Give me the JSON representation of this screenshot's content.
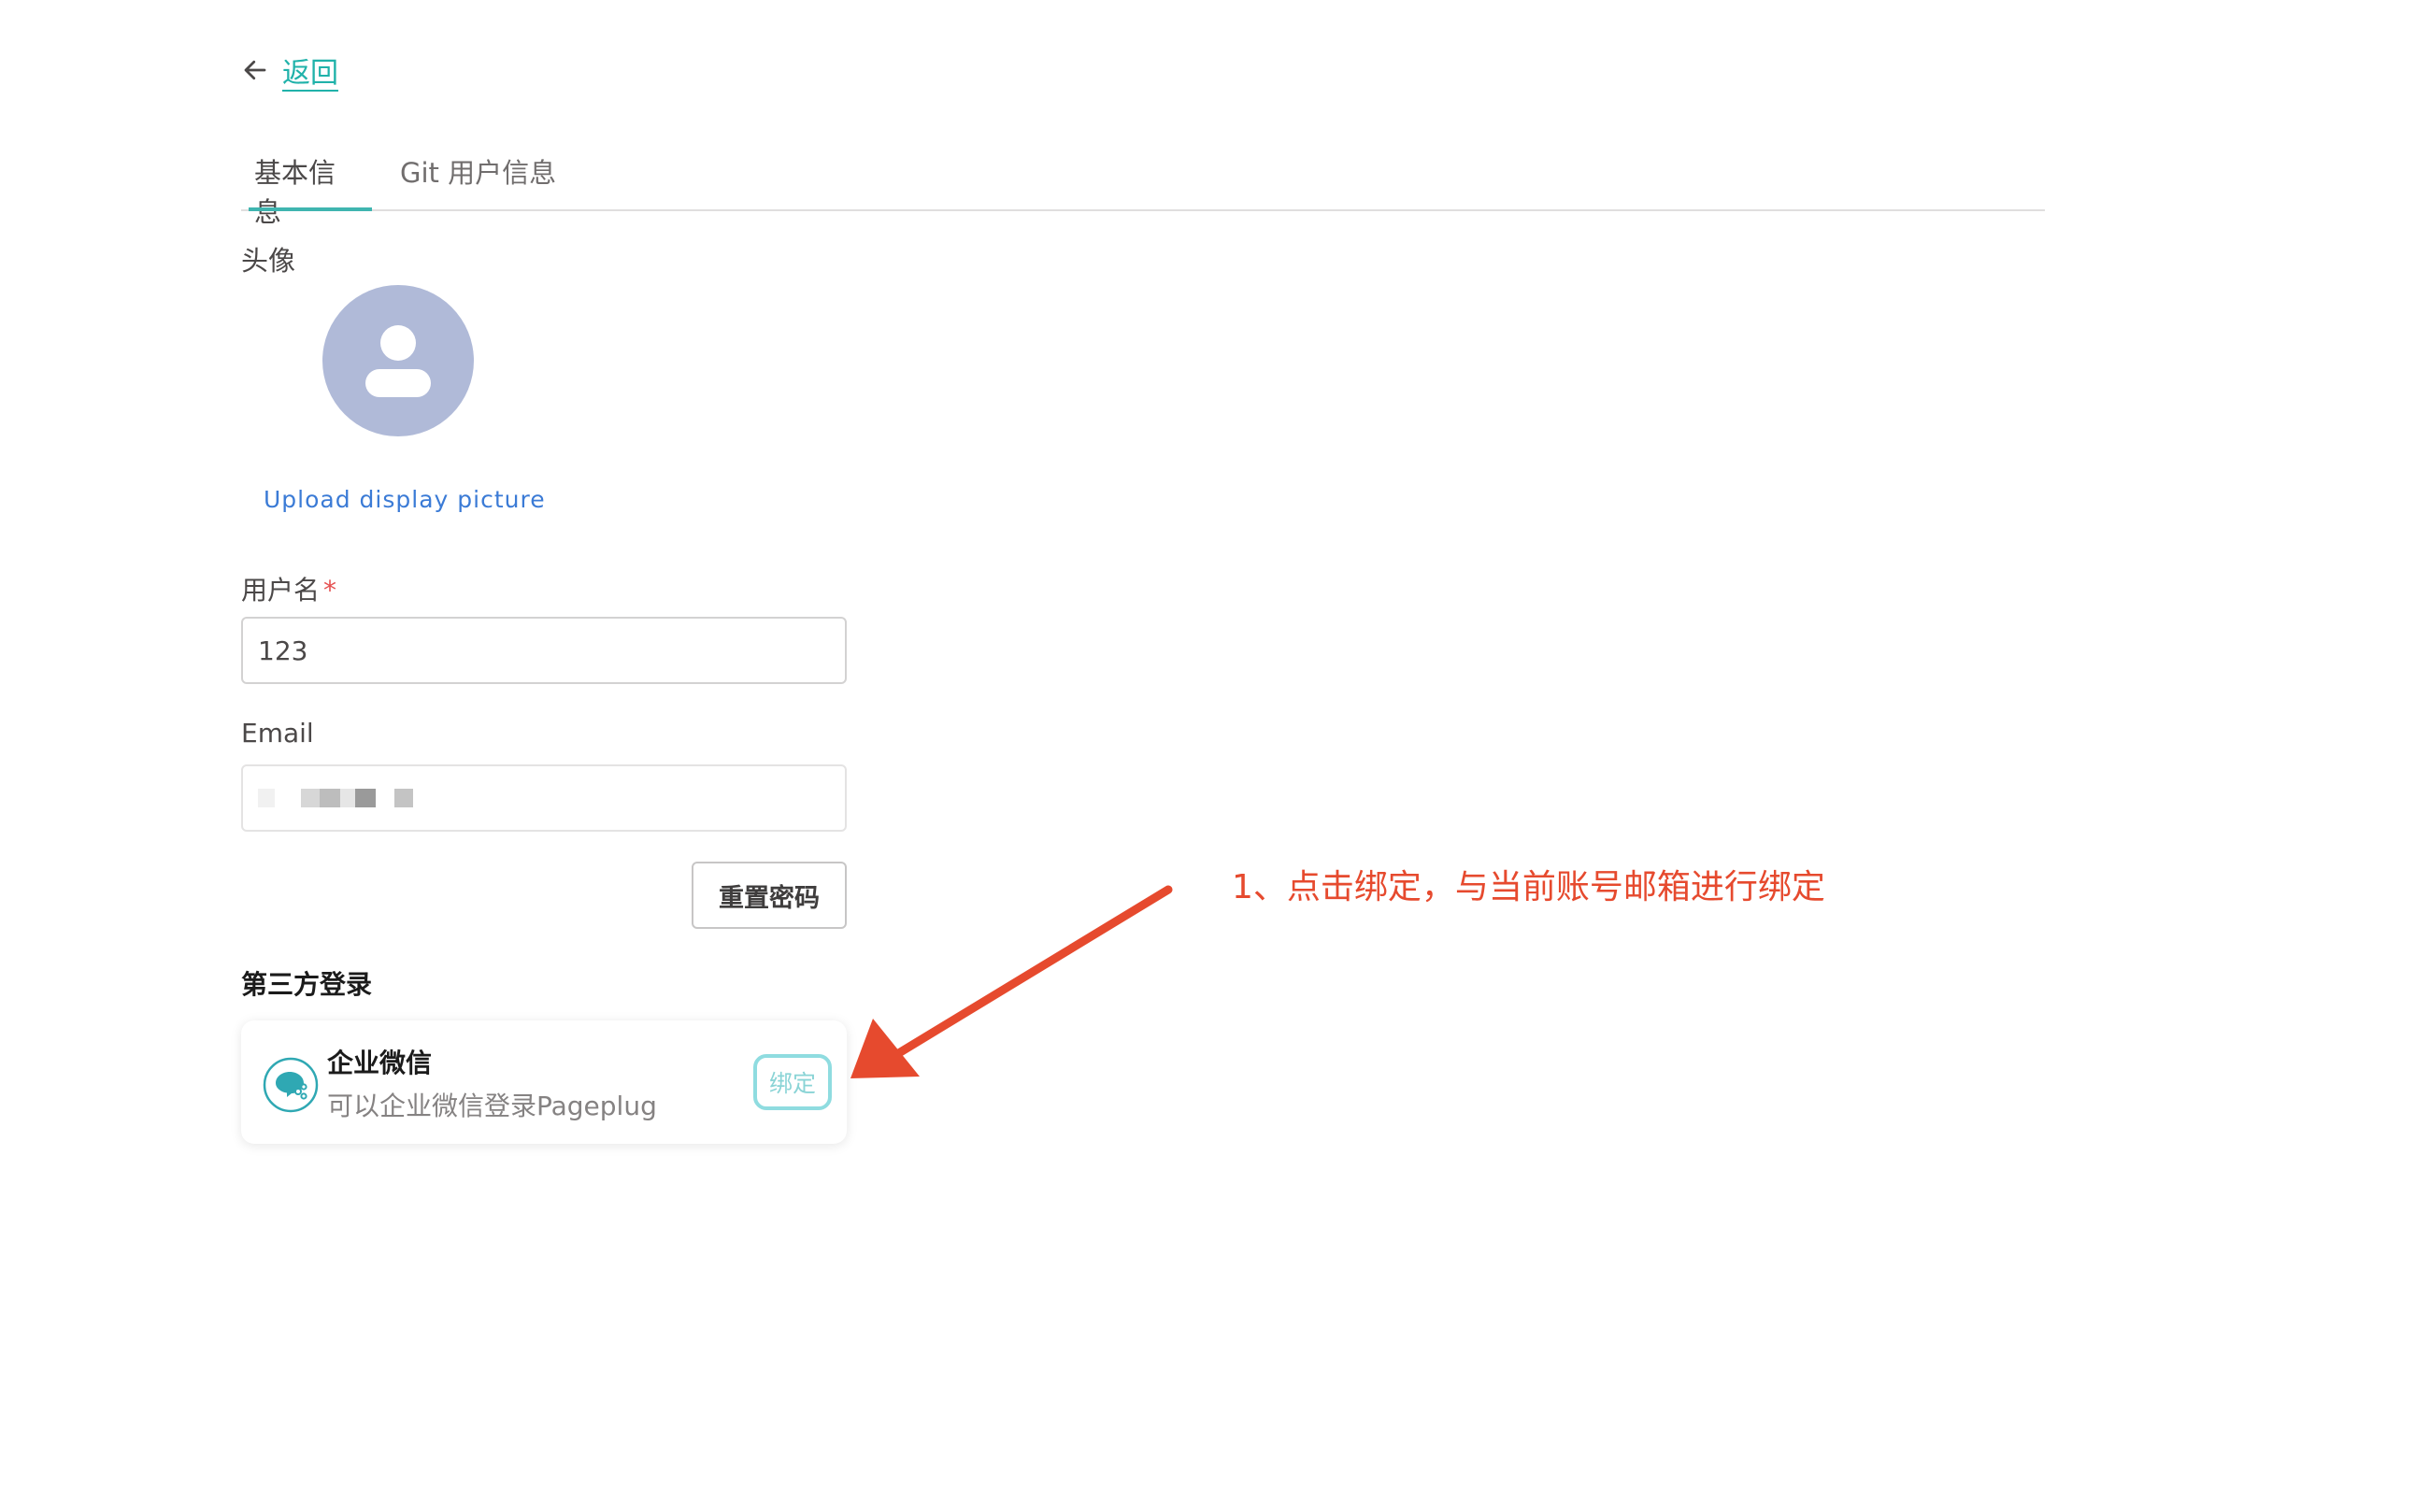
{
  "back": {
    "label": "返回"
  },
  "tabs": [
    {
      "label": "基本信息",
      "active": true
    },
    {
      "label": "Git 用户信息",
      "active": false
    }
  ],
  "avatar": {
    "label": "头像",
    "upload_label": "Upload display picture",
    "icon": "user-icon",
    "bg_color": "#b0bad8"
  },
  "form": {
    "username": {
      "label": "用户名",
      "required_mark": "*",
      "value": "123"
    },
    "email": {
      "label": "Email"
    },
    "reset_password_label": "重置密码"
  },
  "third_party": {
    "title": "第三方登录",
    "items": [
      {
        "name": "企业微信",
        "description": "可以企业微信登录Pageplug",
        "icon": "wecom-icon",
        "bind_label": "绑定"
      }
    ]
  },
  "annotation": {
    "text": "1、点击绑定，与当前账号邮箱进行绑定",
    "color": "#e64a2e"
  },
  "colors": {
    "accent": "#20b2aa",
    "link": "#3b7bd6",
    "required": "#e55050"
  }
}
